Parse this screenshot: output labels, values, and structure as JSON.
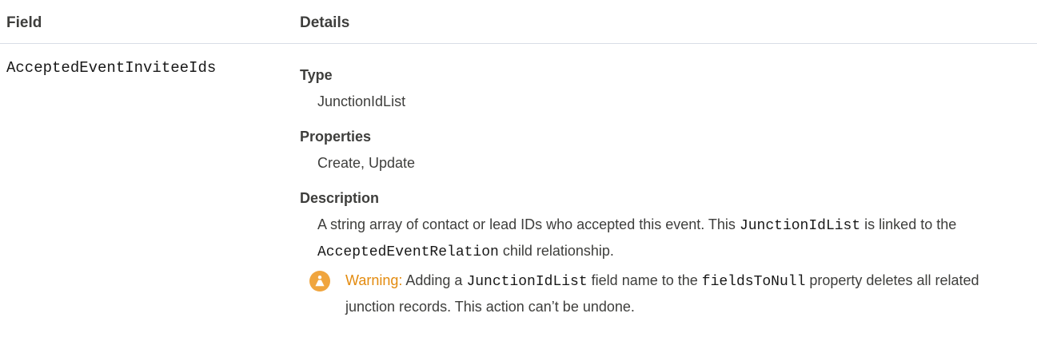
{
  "header": {
    "field_label": "Field",
    "details_label": "Details"
  },
  "row": {
    "field_name": "AcceptedEventInviteeIds",
    "type_term": "Type",
    "type_value": "JunctionIdList",
    "properties_term": "Properties",
    "properties_value": "Create, Update",
    "description_term": "Description",
    "description": {
      "part1": "A string array of contact or lead IDs who accepted this event. This ",
      "code1": "JunctionIdList",
      "part2": " is linked to the ",
      "code2": "AcceptedEventRelation",
      "part3": " child relationship."
    },
    "warning": {
      "icon": "warning-icon",
      "label": "Warning:",
      "part1": " Adding a ",
      "code1": "JunctionIdList",
      "part2": " field name to the ",
      "code2": "fieldsToNull",
      "part3": " property deletes all related junction records. This action can’t be undone."
    }
  },
  "colors": {
    "warning_accent": "#e38b0f",
    "divider": "#d8dde6",
    "text": "#3e3e3c"
  }
}
